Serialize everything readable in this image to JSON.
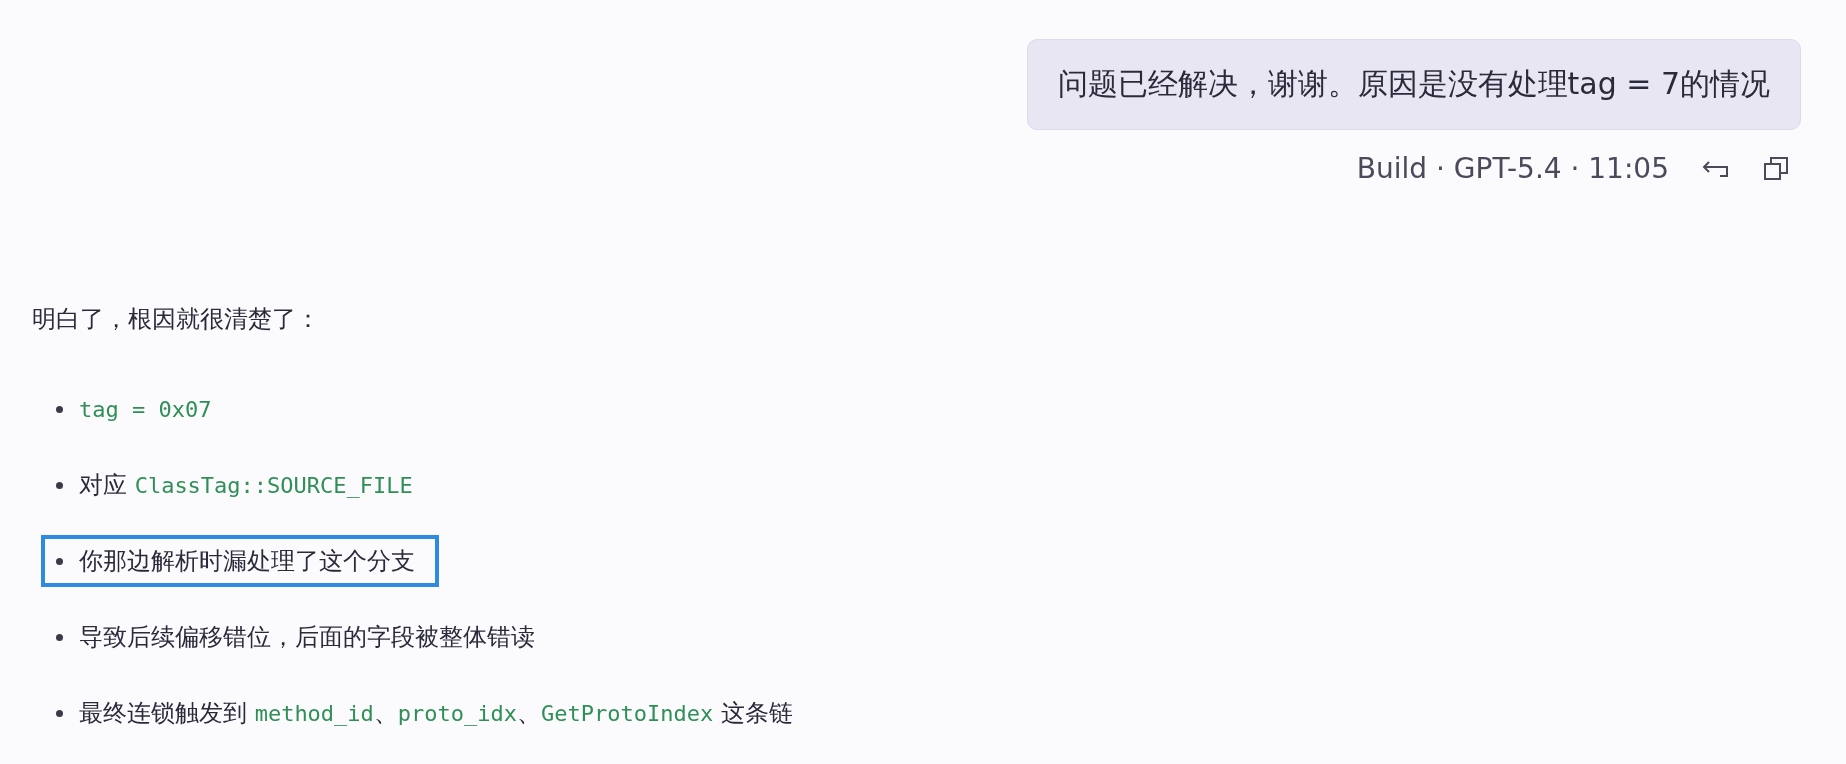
{
  "user_message": {
    "text": "问题已经解决，谢谢。原因是没有处理tag = 7的情况",
    "meta": "Build · GPT-5.4 · 11:05"
  },
  "reply": {
    "intro": "明白了，根因就很清楚了：",
    "items": [
      {
        "highlighted": false,
        "segments": [
          {
            "kind": "code",
            "text": "tag = 0x07"
          }
        ]
      },
      {
        "highlighted": false,
        "segments": [
          {
            "kind": "text",
            "text": "对应 "
          },
          {
            "kind": "code",
            "text": "ClassTag::SOURCE_FILE"
          }
        ]
      },
      {
        "highlighted": true,
        "segments": [
          {
            "kind": "text",
            "text": "你那边解析时漏处理了这个分支"
          }
        ]
      },
      {
        "highlighted": false,
        "segments": [
          {
            "kind": "text",
            "text": "导致后续偏移错位，后面的字段被整体错读"
          }
        ]
      },
      {
        "highlighted": false,
        "segments": [
          {
            "kind": "text",
            "text": "最终连锁触发到 "
          },
          {
            "kind": "code",
            "text": "method_id"
          },
          {
            "kind": "text",
            "text": "、"
          },
          {
            "kind": "code",
            "text": "proto_idx"
          },
          {
            "kind": "text",
            "text": "、"
          },
          {
            "kind": "code",
            "text": "GetProtoIndex"
          },
          {
            "kind": "text",
            "text": " 这条链"
          }
        ]
      }
    ]
  }
}
